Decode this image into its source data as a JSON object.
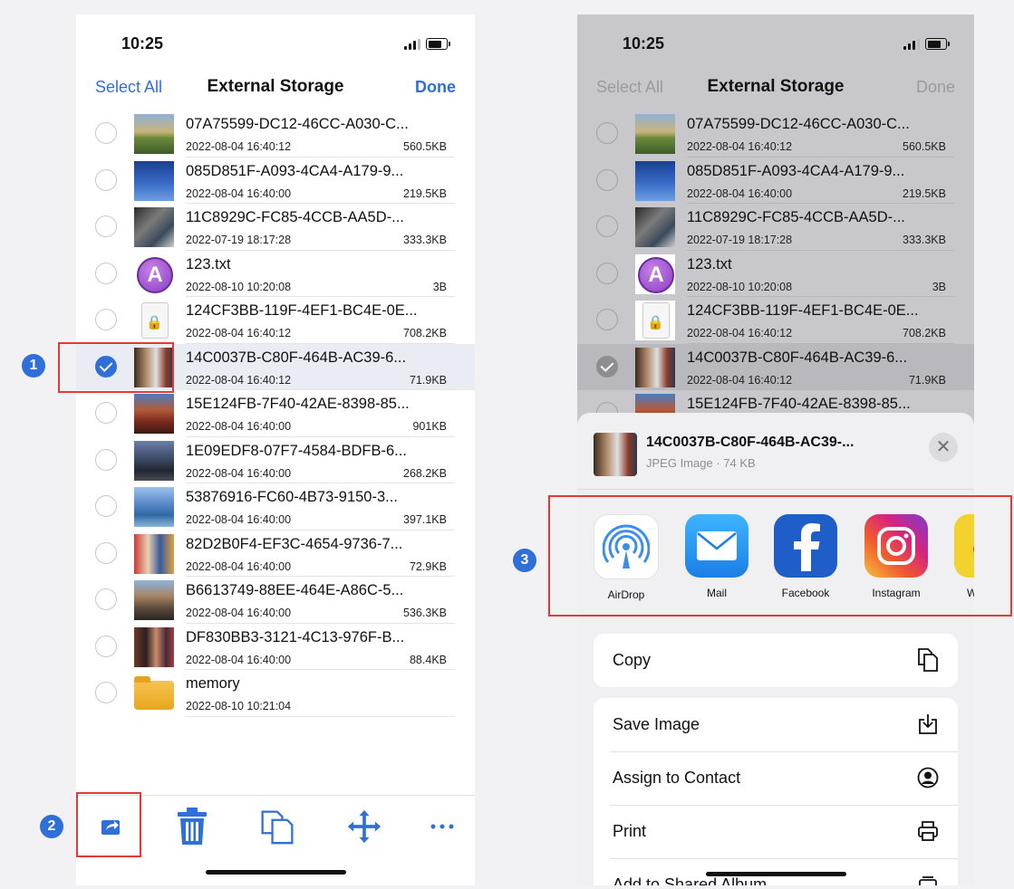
{
  "status": {
    "time": "10:25"
  },
  "navbar": {
    "left": "Select All",
    "title": "External Storage",
    "right": "Done"
  },
  "files": [
    {
      "name": "07A75599-DC12-46CC-A030-C...",
      "date": "2022-08-04 16:40:12",
      "size": "560.5KB",
      "thumb": "landscape",
      "checked": false
    },
    {
      "name": "085D851F-A093-4CA4-A179-9...",
      "date": "2022-08-04 16:40:00",
      "size": "219.5KB",
      "thumb": "blue",
      "checked": false
    },
    {
      "name": "11C8929C-FC85-4CCB-AA5D-...",
      "date": "2022-07-19 18:17:28",
      "size": "333.3KB",
      "thumb": "desk",
      "checked": false
    },
    {
      "name": "123.txt",
      "date": "2022-08-10 10:20:08",
      "size": "3B",
      "thumb": "txt",
      "checked": false
    },
    {
      "name": "124CF3BB-119F-4EF1-BC4E-0E...",
      "date": "2022-08-04 16:40:12",
      "size": "708.2KB",
      "thumb": "lock",
      "checked": false
    },
    {
      "name": "14C0037B-C80F-464B-AC39-6...",
      "date": "2022-08-04 16:40:12",
      "size": "71.9KB",
      "thumb": "group",
      "checked": true
    },
    {
      "name": "15E124FB-7F40-42AE-8398-85...",
      "date": "2022-08-04 16:40:00",
      "size": "901KB",
      "thumb": "canyon",
      "checked": false
    },
    {
      "name": "1E09EDF8-07F7-4584-BDFB-6...",
      "date": "2022-08-04 16:40:00",
      "size": "268.2KB",
      "thumb": "road",
      "checked": false
    },
    {
      "name": "53876916-FC60-4B73-9150-3...",
      "date": "2022-08-04 16:40:00",
      "size": "397.1KB",
      "thumb": "city",
      "checked": false
    },
    {
      "name": "82D2B0F4-EF3C-4654-9736-7...",
      "date": "2022-08-04 16:40:00",
      "size": "72.9KB",
      "thumb": "sport",
      "checked": false
    },
    {
      "name": "B6613749-88EE-464E-A86C-5...",
      "date": "2022-08-04 16:40:00",
      "size": "536.3KB",
      "thumb": "rock",
      "checked": false
    },
    {
      "name": "DF830BB3-3121-4C13-976F-B...",
      "date": "2022-08-04 16:40:00",
      "size": "88.4KB",
      "thumb": "people",
      "checked": false
    },
    {
      "name": "memory",
      "date": "2022-08-10 10:21:04",
      "size": "",
      "thumb": "folder",
      "checked": false
    }
  ],
  "toolbar": {
    "icons": [
      "share-icon",
      "trash-icon",
      "copy-icon",
      "move-icon",
      "more-icon"
    ]
  },
  "sheet": {
    "file_name": "14C0037B-C80F-464B-AC39-...",
    "file_meta": "JPEG Image · 74 KB",
    "close_glyph": "✕",
    "apps": [
      {
        "label": "AirDrop",
        "icon": "airdrop-icon"
      },
      {
        "label": "Mail",
        "icon": "mail-icon"
      },
      {
        "label": "Facebook",
        "icon": "facebook-icon"
      },
      {
        "label": "Instagram",
        "icon": "instagram-icon"
      },
      {
        "label": "W",
        "icon": "weibo-icon"
      }
    ],
    "action_copy": "Copy",
    "actions": [
      {
        "label": "Save Image",
        "icon": "save-image-icon"
      },
      {
        "label": "Assign to Contact",
        "icon": "contact-icon"
      },
      {
        "label": "Print",
        "icon": "print-icon"
      },
      {
        "label": "Add to Shared Album",
        "icon": "shared-album-icon"
      }
    ]
  },
  "annotations": {
    "marker_1": "1",
    "marker_2": "2",
    "marker_3": "3"
  },
  "colors": {
    "accent": "#2f6fd8",
    "highlight": "#e53935"
  }
}
